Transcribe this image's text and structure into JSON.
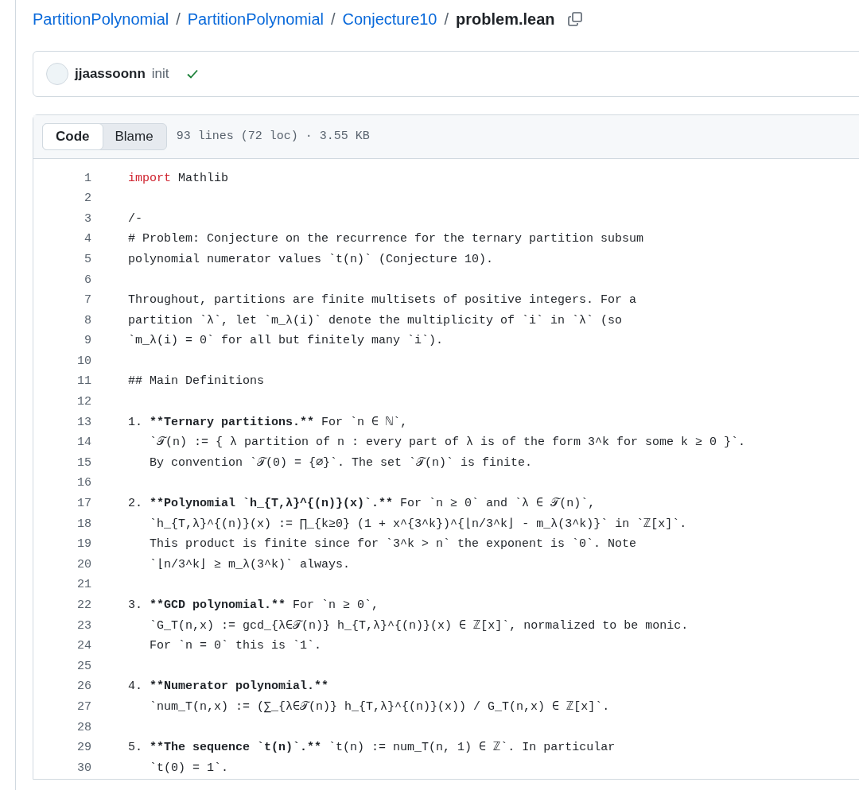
{
  "breadcrumb": {
    "links": [
      "PartitionPolynomial",
      "PartitionPolynomial",
      "Conjecture10"
    ],
    "separator": "/",
    "current": "problem.lean"
  },
  "commit": {
    "author": "jjaassoonn",
    "message": "init",
    "passed": true
  },
  "file_header": {
    "tabs": [
      {
        "label": "Code",
        "selected": true
      },
      {
        "label": "Blame",
        "selected": false
      }
    ],
    "info": "93 lines (72 loc) · 3.55 KB"
  },
  "code": [
    {
      "number": "1",
      "segments": [
        {
          "kind": "keyword",
          "text": "import"
        },
        {
          "kind": "plain",
          "text": " Mathlib"
        }
      ]
    },
    {
      "number": "2"
    },
    {
      "number": "3",
      "segments": [
        {
          "kind": "plain",
          "text": "/-"
        }
      ]
    },
    {
      "number": "4",
      "segments": [
        {
          "kind": "plain",
          "text": "# Problem: Conjecture on the recurrence for the ternary partition subsum"
        }
      ]
    },
    {
      "number": "5",
      "segments": [
        {
          "kind": "plain",
          "text": "polynomial numerator values `t(n)` (Conjecture 10)."
        }
      ]
    },
    {
      "number": "6"
    },
    {
      "number": "7",
      "segments": [
        {
          "kind": "plain",
          "text": "Throughout, partitions are finite multisets of positive integers. For a"
        }
      ]
    },
    {
      "number": "8",
      "segments": [
        {
          "kind": "plain",
          "text": "partition `λ`, let `m_λ(i)` denote the multiplicity of `i` in `λ` (so"
        }
      ]
    },
    {
      "number": "9",
      "segments": [
        {
          "kind": "plain",
          "text": "`m_λ(i) = 0` for all but finitely many `i`)."
        }
      ]
    },
    {
      "number": "10"
    },
    {
      "number": "11",
      "segments": [
        {
          "kind": "plain",
          "text": "## Main Definitions"
        }
      ]
    },
    {
      "number": "12"
    },
    {
      "number": "13",
      "segments": [
        {
          "kind": "plain",
          "text": "1. "
        },
        {
          "kind": "bold",
          "text": "**Ternary partitions.**"
        },
        {
          "kind": "plain",
          "text": " For `n ∈ ℕ`,"
        }
      ]
    },
    {
      "number": "14",
      "segments": [
        {
          "kind": "plain",
          "text": "   `𝒯(n) := { λ partition of n : every part of λ is of the form 3^k for some k ≥ 0 }`."
        }
      ]
    },
    {
      "number": "15",
      "segments": [
        {
          "kind": "plain",
          "text": "   By convention `𝒯(0) = {∅}`. The set `𝒯(n)` is finite."
        }
      ]
    },
    {
      "number": "16"
    },
    {
      "number": "17",
      "segments": [
        {
          "kind": "plain",
          "text": "2. "
        },
        {
          "kind": "bold",
          "text": "**Polynomial `h_{T,λ}^{(n)}(x)`.**"
        },
        {
          "kind": "plain",
          "text": " For `n ≥ 0` and `λ ∈ 𝒯(n)`,"
        }
      ]
    },
    {
      "number": "18",
      "segments": [
        {
          "kind": "plain",
          "text": "   `h_{T,λ}^{(n)}(x) := ∏_{k≥0} (1 + x^{3^k})^{⌊n/3^k⌋ - m_λ(3^k)}` in `ℤ[x]`."
        }
      ]
    },
    {
      "number": "19",
      "segments": [
        {
          "kind": "plain",
          "text": "   This product is finite since for `3^k > n` the exponent is `0`. Note"
        }
      ]
    },
    {
      "number": "20",
      "segments": [
        {
          "kind": "plain",
          "text": "   `⌊n/3^k⌋ ≥ m_λ(3^k)` always."
        }
      ]
    },
    {
      "number": "21"
    },
    {
      "number": "22",
      "segments": [
        {
          "kind": "plain",
          "text": "3. "
        },
        {
          "kind": "bold",
          "text": "**GCD polynomial.**"
        },
        {
          "kind": "plain",
          "text": " For `n ≥ 0`,"
        }
      ]
    },
    {
      "number": "23",
      "segments": [
        {
          "kind": "plain",
          "text": "   `G_T(n,x) := gcd_{λ∈𝒯(n)} h_{T,λ}^{(n)}(x) ∈ ℤ[x]`, normalized to be monic."
        }
      ]
    },
    {
      "number": "24",
      "segments": [
        {
          "kind": "plain",
          "text": "   For `n = 0` this is `1`."
        }
      ]
    },
    {
      "number": "25"
    },
    {
      "number": "26",
      "segments": [
        {
          "kind": "plain",
          "text": "4. "
        },
        {
          "kind": "bold",
          "text": "**Numerator polynomial.**"
        }
      ]
    },
    {
      "number": "27",
      "segments": [
        {
          "kind": "plain",
          "text": "   `num_T(n,x) := (∑_{λ∈𝒯(n)} h_{T,λ}^{(n)}(x)) / G_T(n,x) ∈ ℤ[x]`."
        }
      ]
    },
    {
      "number": "28"
    },
    {
      "number": "29",
      "segments": [
        {
          "kind": "plain",
          "text": "5. "
        },
        {
          "kind": "bold",
          "text": "**The sequence `t(n)`.**"
        },
        {
          "kind": "plain",
          "text": " `t(n) := num_T(n, 1) ∈ ℤ`. In particular"
        }
      ]
    },
    {
      "number": "30",
      "segments": [
        {
          "kind": "plain",
          "text": "   `t(0) = 1`."
        }
      ]
    }
  ]
}
